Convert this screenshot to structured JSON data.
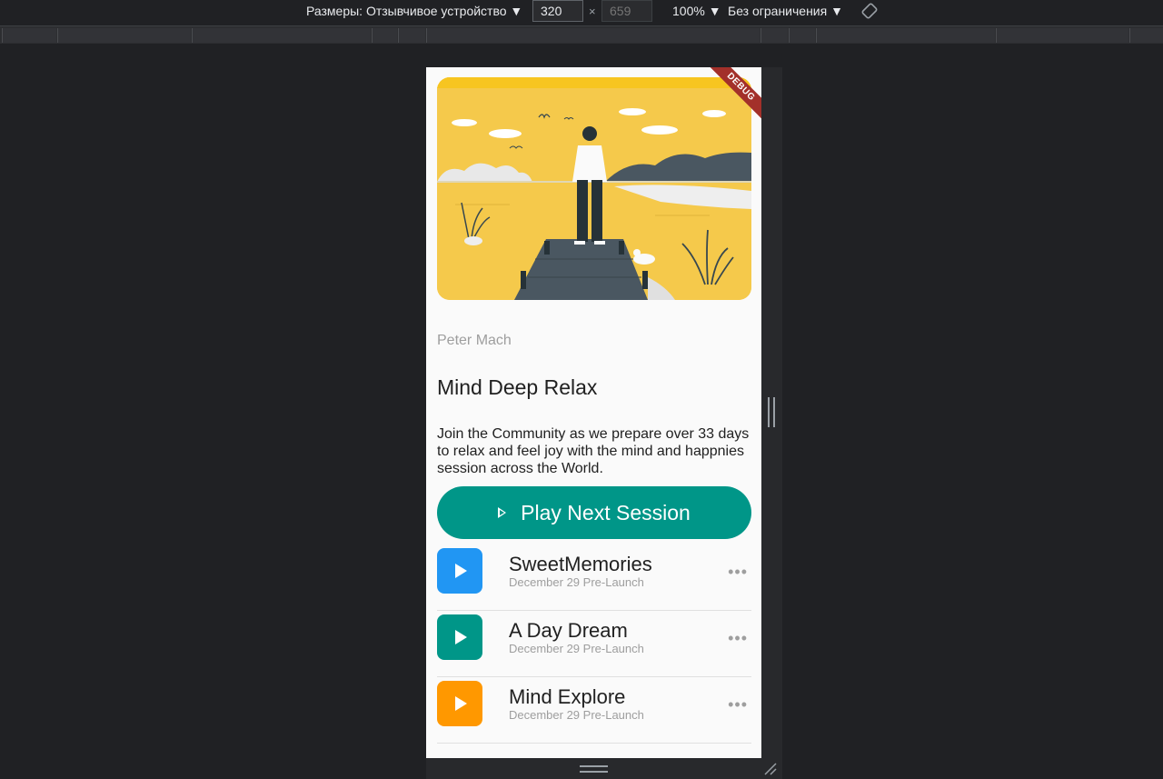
{
  "devtools": {
    "dimensions_label": "Размеры: Отзывчивое устройство ▼",
    "width_value": "320",
    "height_placeholder": "659",
    "times": "×",
    "zoom_label": "100% ▼",
    "throttle_label": "Без ограничения ▼",
    "rotate_icon": "rotate-icon"
  },
  "app": {
    "debug_banner": "DEBUG",
    "author": "Peter Mach",
    "title": "Mind Deep Relax",
    "description": "Join the Community as we prepare over 33 days to relax and feel joy with the mind and happnies session across the World.",
    "play_button_label": "Play Next Session",
    "tracks": [
      {
        "title": "SweetMemories",
        "subtitle": "December 29 Pre-Launch",
        "color": "#2196f3"
      },
      {
        "title": "A Day Dream",
        "subtitle": "December 29 Pre-Launch",
        "color": "#009688"
      },
      {
        "title": "Mind Explore",
        "subtitle": "December 29 Pre-Launch",
        "color": "#ff9800"
      }
    ],
    "more_glyph": "•••"
  },
  "colors": {
    "accent": "#009688",
    "hero_background": "#f5c94b",
    "debug_banner": "#a3302a"
  }
}
